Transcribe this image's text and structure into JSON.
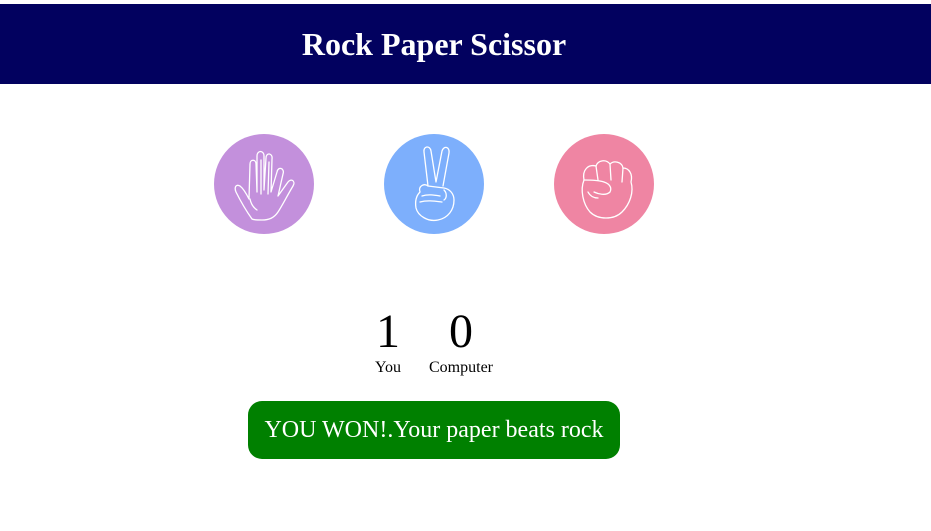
{
  "header": {
    "title": "Rock Paper Scissor",
    "background_color": "#02015f"
  },
  "choices": [
    {
      "name": "paper",
      "icon": "open-hand-icon",
      "color": "#c390dc"
    },
    {
      "name": "scissors",
      "icon": "peace-sign-hand-icon",
      "color": "#7daffc"
    },
    {
      "name": "rock",
      "icon": "fist-icon",
      "color": "#ef85a3"
    }
  ],
  "score": {
    "you": {
      "value": "1",
      "label": "You"
    },
    "computer": {
      "value": "0",
      "label": "Computer"
    }
  },
  "result": {
    "message": "YOU WON!.Your paper beats rock",
    "background_color": "#008000"
  }
}
